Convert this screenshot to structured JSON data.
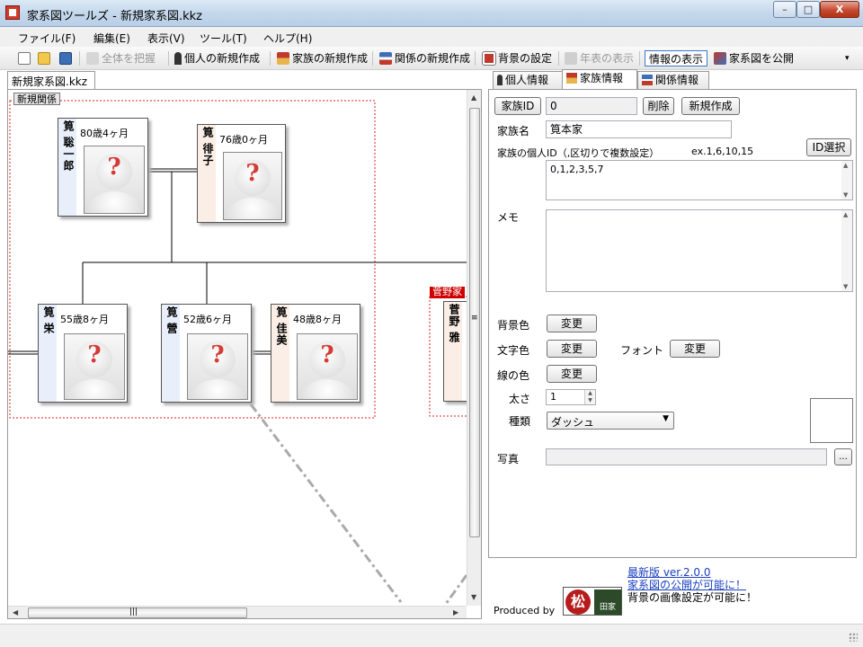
{
  "window": {
    "title": "家系図ツールズ  -  新規家系図.kkz",
    "min_label": "–",
    "max_label": "□",
    "close_label": "X"
  },
  "menu": [
    "ファイル(F)",
    "編集(E)",
    "表示(V)",
    "ツール(T)",
    "ヘルプ(H)"
  ],
  "toolbar": {
    "fit_all": "全体を把握",
    "new_person": "個人の新規作成",
    "new_family": "家族の新規作成",
    "new_relation": "関係の新規作成",
    "background": "背景の設定",
    "timeline": "年表の表示",
    "info": "情報の表示",
    "publish": "家系図を公開"
  },
  "document": {
    "tab": "新規家系図.kkz",
    "group_label": "新規関係",
    "group_label_2": "菅野家",
    "persons": [
      {
        "name": "筧 聡一郎",
        "age": "80歳4ヶ月",
        "sex": "male"
      },
      {
        "name": "筧 徘子",
        "age": "76歳0ヶ月",
        "sex": "female"
      },
      {
        "name": "筧 栄",
        "age": "55歳8ヶ月",
        "sex": "male"
      },
      {
        "name": "筧 營",
        "age": "52歳6ヶ月",
        "sex": "male"
      },
      {
        "name": "筧 佳美",
        "age": "48歳8ヶ月",
        "sex": "female"
      },
      {
        "name": "菅野 雅",
        "age": "",
        "sex": "female"
      }
    ],
    "hscroll_glyph": "|||",
    "vscroll_glyph": "≡"
  },
  "panel": {
    "tabs": [
      "個人情報",
      "家族情報",
      "関係情報"
    ],
    "active_tab": "家族情報",
    "family_id_label": "家族ID",
    "family_id_value": "0",
    "delete_button": "削除",
    "new_button": "新規作成",
    "family_name_label": "家族名",
    "family_name_value": "筧本家",
    "member_ids_label": "家族の個人ID（,区切りで複数設定）",
    "member_ids_example": "ex.1,6,10,15",
    "id_select_button": "ID選択",
    "member_ids_value": "0,1,2,3,5,7",
    "memo_label": "メモ",
    "memo_value": "",
    "bg_color_label": "背景色",
    "text_color_label": "文字色",
    "font_label": "フォント",
    "line_color_label": "線の色",
    "change_button": "変更",
    "thickness_label": "太さ",
    "thickness_value": "1",
    "type_label": "種類",
    "type_value": "ダッシュ",
    "photo_label": "写真",
    "photo_value": "",
    "browse_button": "..."
  },
  "footer": {
    "produced_by": "Produced by",
    "logo_seal": "松",
    "logo_text": "田家",
    "latest": "最新版 ver.2.0.0",
    "publish_news": "家系図の公開が可能に！",
    "bg_news": "背景の画像設定が可能に！"
  }
}
